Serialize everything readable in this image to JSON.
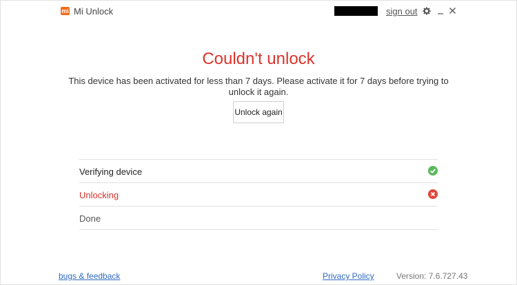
{
  "titlebar": {
    "logo_text": "mi",
    "title": "Mi Unlock",
    "sign_out": "sign out",
    "icons": [
      "gear-icon",
      "minimize-icon",
      "close-icon"
    ]
  },
  "main": {
    "title": "Couldn't unlock",
    "message": "This device has been activated for less than 7 days. Please activate it for 7 days before trying to unlock it again.",
    "unlock_again": "Unlock again"
  },
  "steps": [
    {
      "label": "Verifying device",
      "status": "success",
      "icon": "check-circle-icon"
    },
    {
      "label": "Unlocking",
      "status": "failed",
      "icon": "error-circle-icon"
    },
    {
      "label": "Done",
      "status": "pending"
    }
  ],
  "footer": {
    "bugs_feedback": "bugs & feedback",
    "privacy_policy": "Privacy Policy",
    "version": "Version: 7.6.727.43"
  },
  "colors": {
    "brand": "#f26b1d",
    "error": "#d9342b",
    "success": "#5cb85c",
    "link": "#2f6ac4"
  }
}
